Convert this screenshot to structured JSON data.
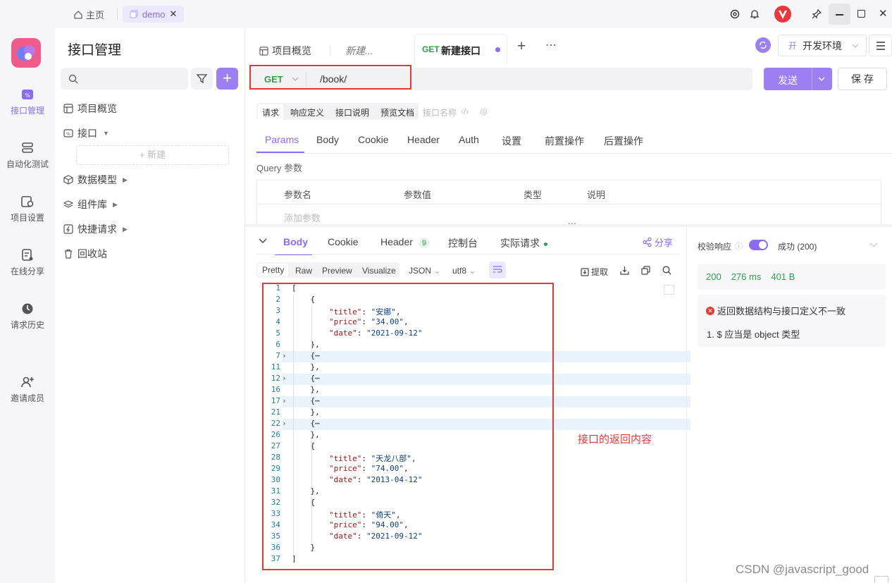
{
  "topbar": {
    "home_label": "主页",
    "tab_label": "demo"
  },
  "leftnav": {
    "items": [
      {
        "label": "接口管理",
        "active": true
      },
      {
        "label": "自动化测试"
      },
      {
        "label": "项目设置"
      },
      {
        "label": "在线分享"
      },
      {
        "label": "请求历史"
      },
      {
        "label": "邀请成员"
      }
    ]
  },
  "panel": {
    "title": "接口管理",
    "search_placeholder": "",
    "tree": [
      {
        "label": "项目概览"
      },
      {
        "label": "接口"
      },
      {
        "label": "新建"
      },
      {
        "label": "数据模型"
      },
      {
        "label": "组件库"
      },
      {
        "label": "快捷请求"
      },
      {
        "label": "回收站"
      }
    ]
  },
  "tabs": [
    {
      "label": "项目概览"
    },
    {
      "label": "新建..."
    },
    {
      "method": "GET",
      "label": "新建接口"
    }
  ],
  "env": {
    "badge": "开",
    "label": "开发环境"
  },
  "request": {
    "method": "GET",
    "url": "/book/",
    "send": "发送",
    "save": "保 存"
  },
  "mode_tabs": [
    "请求",
    "响应定义",
    "接口说明",
    "预览文档"
  ],
  "name_placeholder": "接口名称",
  "param_tabs": [
    "Params",
    "Body",
    "Cookie",
    "Header",
    "Auth",
    "设置",
    "前置操作",
    "后置操作"
  ],
  "query": {
    "title": "Query 参数",
    "columns": [
      "参数名",
      "参数值",
      "类型",
      "说明"
    ],
    "add": "添加参数"
  },
  "response_tabs": {
    "body": "Body",
    "cookie": "Cookie",
    "header": "Header",
    "header_count": "9",
    "console": "控制台",
    "actual": "实际请求",
    "share": "分享"
  },
  "view_tabs": [
    "Pretty",
    "Raw",
    "Preview",
    "Visualize"
  ],
  "format": "JSON",
  "encoding": "utf8",
  "extract": "提取",
  "code_lines": [
    {
      "n": "1",
      "t": "["
    },
    {
      "n": "2",
      "t": "    {"
    },
    {
      "n": "3",
      "k": "\"title\"",
      "v": "\"安娜\""
    },
    {
      "n": "4",
      "k": "\"price\"",
      "v": "\"34.00\""
    },
    {
      "n": "5",
      "k": "\"date\"",
      "v": "\"2021-09-12\"",
      "last": true
    },
    {
      "n": "6",
      "t": "    },"
    },
    {
      "n": "7",
      "t": "    {⋯",
      "fold": true
    },
    {
      "n": "11",
      "t": "    },"
    },
    {
      "n": "12",
      "t": "    {⋯",
      "fold": true
    },
    {
      "n": "16",
      "t": "    },"
    },
    {
      "n": "17",
      "t": "    {⋯",
      "fold": true
    },
    {
      "n": "21",
      "t": "    },"
    },
    {
      "n": "22",
      "t": "    {⋯",
      "fold": true
    },
    {
      "n": "26",
      "t": "    },"
    },
    {
      "n": "27",
      "t": "    {"
    },
    {
      "n": "28",
      "k": "\"title\"",
      "v": "\"天龙八部\""
    },
    {
      "n": "29",
      "k": "\"price\"",
      "v": "\"74.00\""
    },
    {
      "n": "30",
      "k": "\"date\"",
      "v": "\"2013-04-12\"",
      "last": true
    },
    {
      "n": "31",
      "t": "    },"
    },
    {
      "n": "32",
      "t": "    {"
    },
    {
      "n": "33",
      "k": "\"title\"",
      "v": "\"倚天\""
    },
    {
      "n": "34",
      "k": "\"price\"",
      "v": "\"94.00\""
    },
    {
      "n": "35",
      "k": "\"date\"",
      "v": "\"2021-09-12\"",
      "last": true
    },
    {
      "n": "36",
      "t": "    }"
    },
    {
      "n": "37",
      "t": "]"
    }
  ],
  "annotation": "接口的返回内容",
  "validate": {
    "label": "校验响应",
    "status": "成功 (200)",
    "code": "200",
    "time": "276 ms",
    "size": "401 B",
    "error": "返回数据结构与接口定义不一致",
    "detail": "1. $ 应当是 object 类型"
  },
  "watermark": "CSDN @javascript_good",
  "colors": {
    "accent": "#8a6cf0",
    "get": "#2da14a",
    "annotation_red": "#e53935"
  }
}
